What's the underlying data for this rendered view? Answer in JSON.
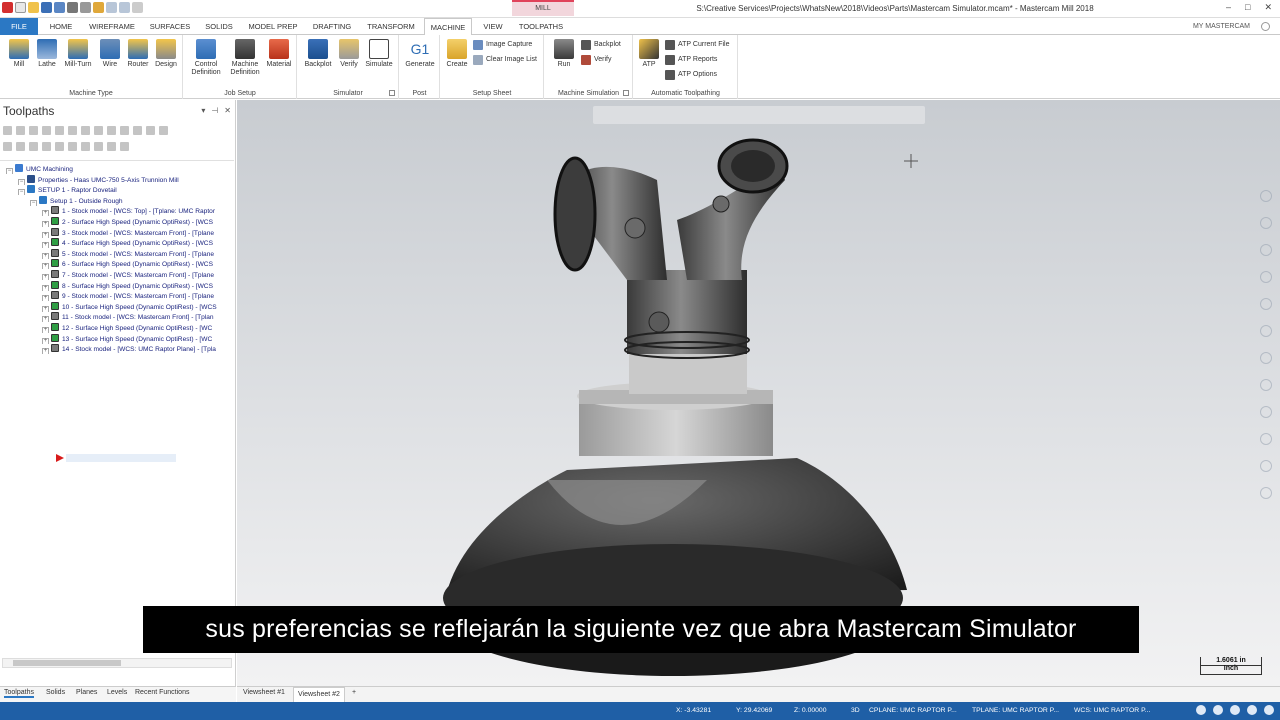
{
  "titlebar": {
    "context_tab": "MILL",
    "title": "S:\\Creative Services\\Projects\\WhatsNew\\2018\\Videos\\Parts\\Mastercam Simulator.mcam* - Mastercam Mill 2018",
    "controls": [
      "–",
      "□",
      "✕"
    ]
  },
  "tabs": [
    "FILE",
    "HOME",
    "WIREFRAME",
    "SURFACES",
    "SOLIDS",
    "MODEL PREP",
    "DRAFTING",
    "TRANSFORM",
    "MACHINE",
    "VIEW",
    "TOOLPATHS"
  ],
  "active_tab": "MACHINE",
  "my_mastercam": "MY MASTERCAM",
  "ribbon": {
    "machine_type": {
      "label": "Machine Type",
      "buttons": [
        "Mill",
        "Lathe",
        "Mill-Turn",
        "Wire",
        "Router",
        "Design"
      ]
    },
    "job_setup": {
      "label": "Job Setup",
      "buttons": [
        "Control\nDefinition",
        "Machine\nDefinition",
        "Material"
      ]
    },
    "simulator": {
      "label": "Simulator",
      "buttons": [
        "Backplot",
        "Verify",
        "Simulate"
      ]
    },
    "post": {
      "label": "Post",
      "buttons": [
        "Generate"
      ]
    },
    "setup_sheet": {
      "label": "Setup Sheet",
      "create": "Create",
      "small": [
        "Image Capture",
        "Clear Image List"
      ]
    },
    "machine_simulation": {
      "label": "Machine Simulation",
      "run": "Run",
      "small": [
        "Backplot",
        "Verify"
      ]
    },
    "atp": {
      "label": "Automatic Toolpathing",
      "big": "ATP",
      "small": [
        "ATP Current File",
        "ATP Reports",
        "ATP Options"
      ]
    }
  },
  "panel": {
    "title": "Toolpaths",
    "tree": [
      {
        "text": "UMC Machining",
        "level": 0,
        "icon": "machine-group-icon"
      },
      {
        "text": "Properties - Haas UMC-750 5-Axis Trunnion Mill",
        "level": 1,
        "icon": "properties-icon"
      },
      {
        "text": "SETUP 1 - Raptor Dovetail",
        "level": 1,
        "icon": "toolpath-group-icon"
      },
      {
        "text": "Setup 1 - Outside Rough",
        "level": 2,
        "icon": "toolpath-group-icon"
      },
      {
        "text": "1 - Stock model - [WCS: Top] - [Tplane: UMC Raptor",
        "level": 3,
        "icon": "stock-model-icon"
      },
      {
        "text": "2 - Surface High Speed (Dynamic OptiRest) - [WCS",
        "level": 3,
        "icon": "operation-icon"
      },
      {
        "text": "3 - Stock model - [WCS: Mastercam Front] - [Tplane",
        "level": 3,
        "icon": "stock-model-icon"
      },
      {
        "text": "4 - Surface High Speed (Dynamic OptiRest) - [WCS",
        "level": 3,
        "icon": "operation-icon"
      },
      {
        "text": "5 - Stock model - [WCS: Mastercam Front] - [Tplane",
        "level": 3,
        "icon": "stock-model-icon"
      },
      {
        "text": "6 - Surface High Speed (Dynamic OptiRest) - [WCS",
        "level": 3,
        "icon": "operation-icon"
      },
      {
        "text": "7 - Stock model - [WCS: Mastercam Front] - [Tplane",
        "level": 3,
        "icon": "stock-model-icon"
      },
      {
        "text": "8 - Surface High Speed (Dynamic OptiRest) - [WCS",
        "level": 3,
        "icon": "operation-icon"
      },
      {
        "text": "9 - Stock model - [WCS: Mastercam Front] - [Tplane",
        "level": 3,
        "icon": "stock-model-icon"
      },
      {
        "text": "10 - Surface High Speed (Dynamic OptiRest) - [WCS",
        "level": 3,
        "icon": "operation-icon"
      },
      {
        "text": "11 - Stock model - [WCS: Mastercam Front] - [Tplan",
        "level": 3,
        "icon": "stock-model-icon"
      },
      {
        "text": "12 - Surface High Speed (Dynamic OptiRest) - [WC",
        "level": 3,
        "icon": "operation-icon"
      },
      {
        "text": "13 - Surface High Speed (Dynamic OptiRest) - [WC",
        "level": 3,
        "icon": "operation-icon"
      },
      {
        "text": "14 - Stock model - [WCS: UMC Raptor Plane] - [Tpla",
        "level": 3,
        "icon": "stock-model-icon"
      }
    ]
  },
  "bottom_tabs": [
    "Toolpaths",
    "Solids",
    "Planes",
    "Levels",
    "Recent Functions"
  ],
  "viewsheets": [
    "Viewsheet #1",
    "Viewsheet #2",
    "+"
  ],
  "scale": {
    "value": "1.6061 in",
    "unit": "Inch"
  },
  "subtitle": "sus preferencias se reflejarán la siguiente vez que abra Mastercam Simulator",
  "statusbar": {
    "x": "X:    -3.43281",
    "y": "Y:    29.42069",
    "z": "Z:    0.00000",
    "mode": "3D",
    "cplane": "CPLANE: UMC RAPTOR P...",
    "tplane": "TPLANE: UMC RAPTOR P...",
    "wcs": "WCS: UMC RAPTOR P..."
  },
  "colors": {
    "file_tab": "#2b78c4",
    "status_bar": "#1f5fa6",
    "context_tab_accent": "#e0435b"
  }
}
